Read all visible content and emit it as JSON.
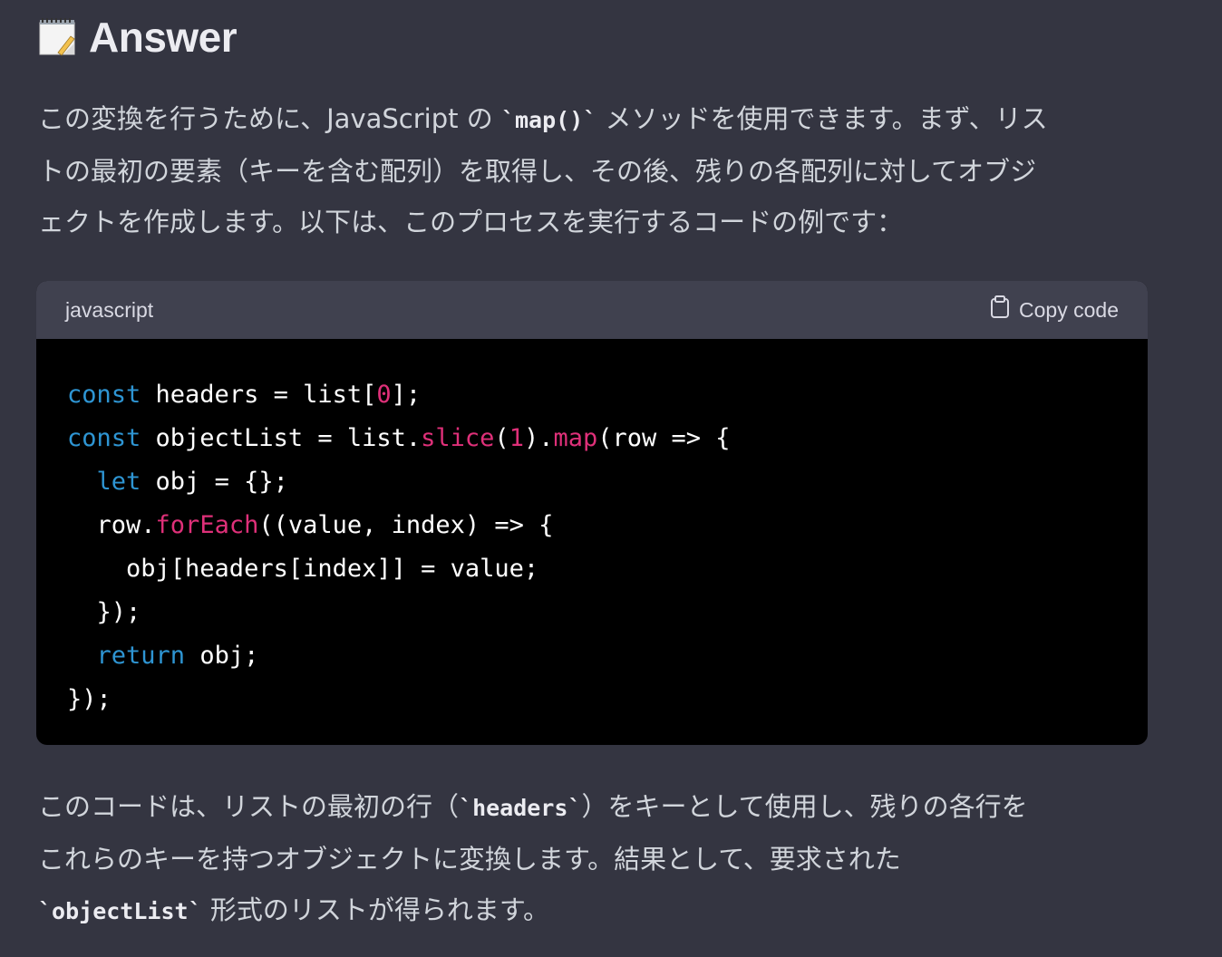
{
  "heading": {
    "icon": "memo-icon",
    "title": "Answer"
  },
  "para1": {
    "line1_pre": "この変換を行うために、JavaScript の ",
    "line1_code": "`map()`",
    "line1_post": " メソッドを使用できます。まず、リス",
    "line2": "トの最初の要素（キーを含む配列）を取得し、その後、残りの各配列に対してオブジ",
    "line3": "ェクトを作成します。以下は、このプロセスを実行するコードの例です："
  },
  "codeblock": {
    "language": "javascript",
    "copy_label": "Copy code",
    "lines": [
      [
        {
          "t": "kw",
          "v": "const"
        },
        {
          "t": "p",
          "v": " headers = list["
        },
        {
          "t": "num",
          "v": "0"
        },
        {
          "t": "p",
          "v": "];"
        }
      ],
      [
        {
          "t": "kw",
          "v": "const"
        },
        {
          "t": "p",
          "v": " objectList = list."
        },
        {
          "t": "fn",
          "v": "slice"
        },
        {
          "t": "p",
          "v": "("
        },
        {
          "t": "num",
          "v": "1"
        },
        {
          "t": "p",
          "v": ")."
        },
        {
          "t": "fn",
          "v": "map"
        },
        {
          "t": "p",
          "v": "(row => {"
        }
      ],
      [
        {
          "t": "p",
          "v": "  "
        },
        {
          "t": "kw",
          "v": "let"
        },
        {
          "t": "p",
          "v": " obj = {};"
        }
      ],
      [
        {
          "t": "p",
          "v": "  row."
        },
        {
          "t": "fn",
          "v": "forEach"
        },
        {
          "t": "p",
          "v": "((value, index) => {"
        }
      ],
      [
        {
          "t": "p",
          "v": "    obj[headers[index]] = value;"
        }
      ],
      [
        {
          "t": "p",
          "v": "  });"
        }
      ],
      [
        {
          "t": "p",
          "v": "  "
        },
        {
          "t": "kw",
          "v": "return"
        },
        {
          "t": "p",
          "v": " obj;"
        }
      ],
      [
        {
          "t": "p",
          "v": "});"
        }
      ]
    ]
  },
  "para2": {
    "line1_pre": "このコードは、リストの最初の行（",
    "line1_code": "`headers`",
    "line1_post": "）をキーとして使用し、残りの各行を",
    "line2": "これらのキーを持つオブジェクトに変換します。結果として、要求された",
    "line3_code": "`objectList`",
    "line3_post": " 形式のリストが得られます。"
  },
  "colors": {
    "background": "#343541",
    "code_keyword": "#2e95d3",
    "code_function": "#df3079"
  }
}
